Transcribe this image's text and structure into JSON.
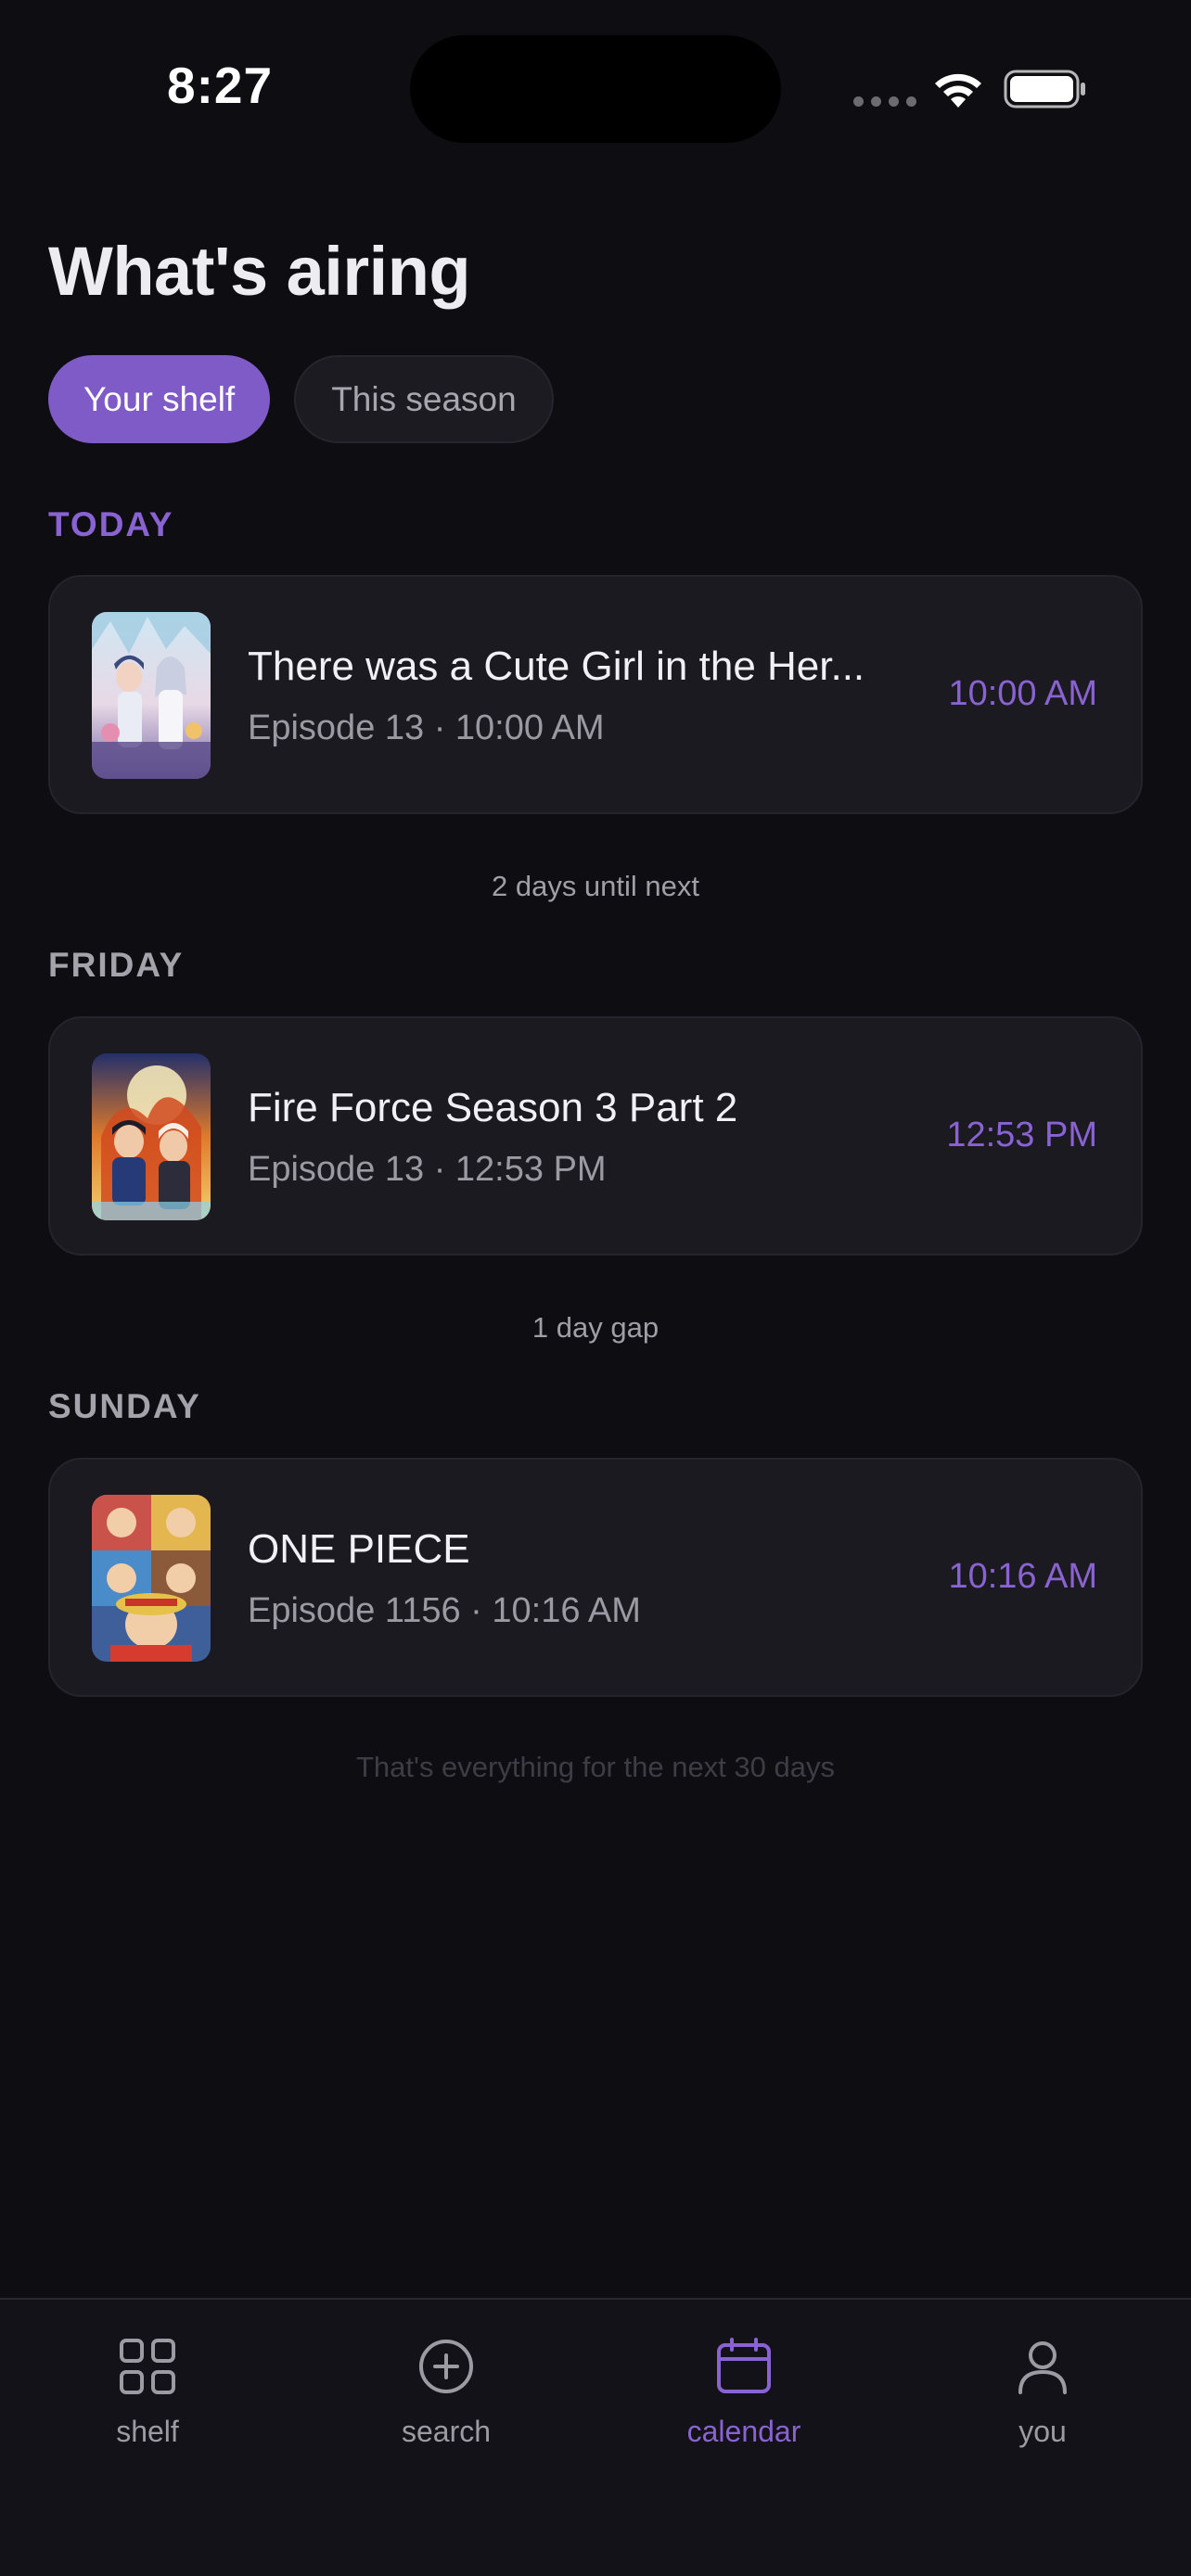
{
  "status_bar": {
    "time": "8:27"
  },
  "header": {
    "title": "What's airing",
    "segments": [
      {
        "label": "Your shelf",
        "active": true
      },
      {
        "label": "This season",
        "active": false
      }
    ]
  },
  "sections": [
    {
      "day": "TODAY",
      "item": {
        "title": "There was a Cute Girl in the Her...",
        "subtitle": "Episode 13 · 10:00 AM",
        "time": "10:00 AM"
      },
      "gap_note": "2 days until next"
    },
    {
      "day": "FRIDAY",
      "item": {
        "title": "Fire Force Season 3 Part 2",
        "subtitle": "Episode 13 · 12:53 PM",
        "time": "12:53 PM"
      },
      "gap_note": "1 day gap"
    },
    {
      "day": "SUNDAY",
      "item": {
        "title": "ONE PIECE",
        "subtitle": "Episode 1156 · 10:16 AM",
        "time": "10:16 AM"
      }
    }
  ],
  "end_note": "That's everything for the next 30 days",
  "tab_bar": {
    "tabs": [
      {
        "label": "shelf",
        "icon": "grid-icon",
        "active": false
      },
      {
        "label": "search",
        "icon": "plus-circle-icon",
        "active": false
      },
      {
        "label": "calendar",
        "icon": "calendar-icon",
        "active": true
      },
      {
        "label": "you",
        "icon": "person-icon",
        "active": false
      }
    ]
  },
  "colors": {
    "background": "#0e0d12",
    "accent": "#8a63d2",
    "segment_active": "#7e5bc7",
    "card": "#1b1a21"
  }
}
